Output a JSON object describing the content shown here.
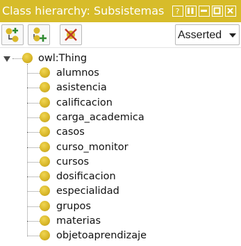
{
  "window": {
    "title": "Class hierarchy: Subsistemas",
    "buttons": [
      "pin-icon",
      "split-icon",
      "minimize-icon",
      "maximize-icon",
      "close-icon"
    ],
    "title_color": "#d7bc2a"
  },
  "toolbar": {
    "buttons": [
      "add-subclass-icon",
      "add-sibling-class-icon",
      "delete-class-icon"
    ],
    "view_selector": {
      "selected": "Asserted"
    }
  },
  "tree": {
    "root": {
      "label": "owl:Thing",
      "expanded": true
    },
    "children": [
      "alumnos",
      "asistencia",
      "calificacion",
      "carga_academica",
      "casos",
      "curso_monitor",
      "cursos",
      "dosificacion",
      "especialidad",
      "grupos",
      "materias",
      "objetoaprendizaje"
    ],
    "class_icon_color": "#d9b82a"
  }
}
